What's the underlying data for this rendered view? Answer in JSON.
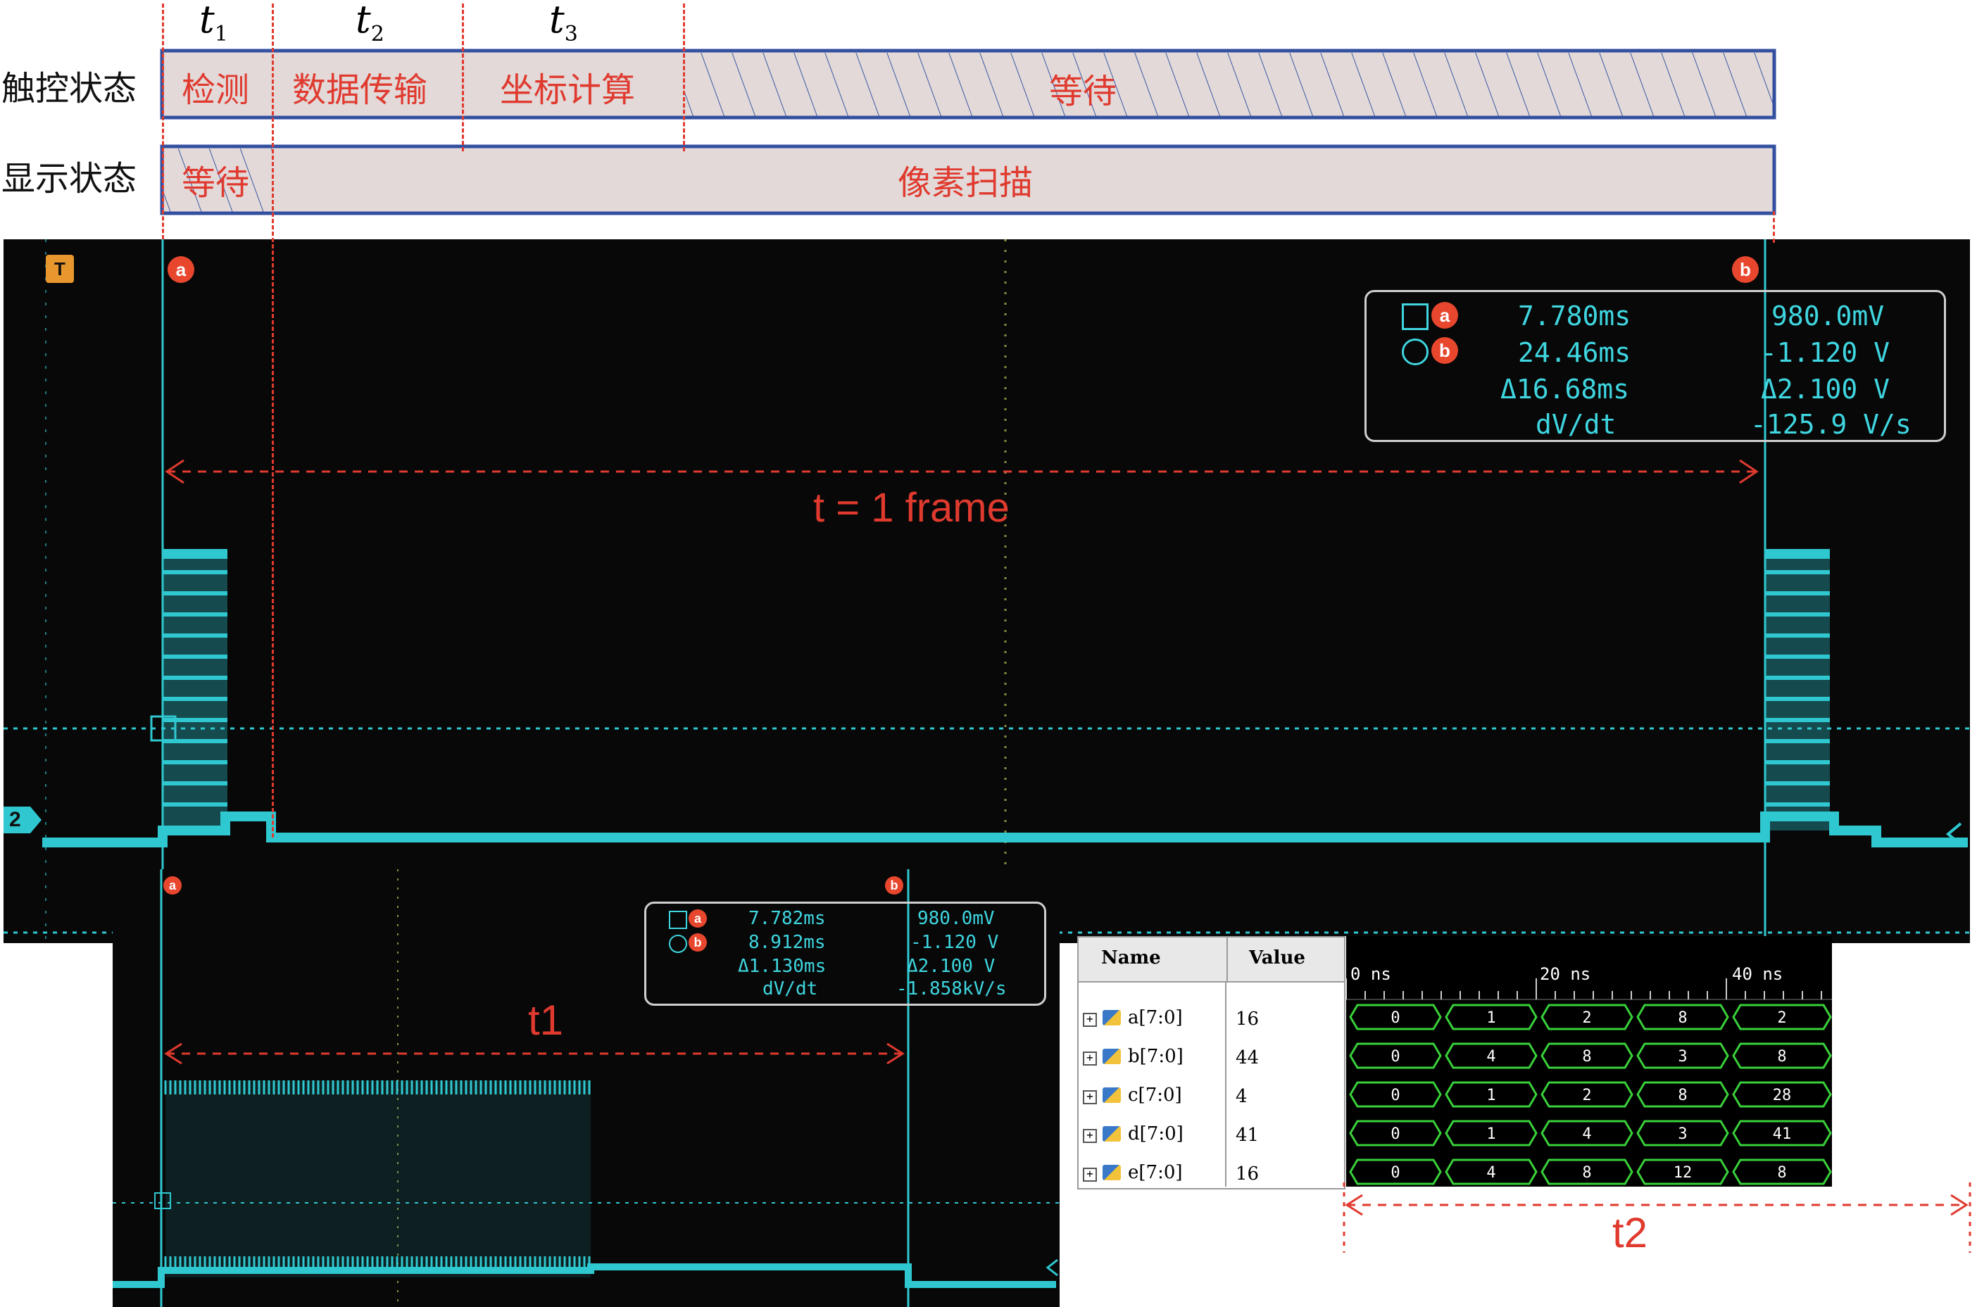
{
  "timeline": {
    "t_labels": [
      {
        "main": "t",
        "sub": "1"
      },
      {
        "main": "t",
        "sub": "2"
      },
      {
        "main": "t",
        "sub": "3"
      }
    ],
    "touch_row": {
      "label": "触控状态",
      "phases": [
        "检测",
        "数据传输",
        "坐标计算",
        "等待"
      ]
    },
    "display_row": {
      "label": "显示状态",
      "phases": [
        "等待",
        "像素扫描"
      ]
    },
    "colors": {
      "bar_fill": "#e2d9d8",
      "bar_border": "#3350a0",
      "phase_text": "#e03a2f",
      "dash": "#e03a2f"
    }
  },
  "main_scope": {
    "trigger_icon": "T",
    "channel": "2",
    "cursor_a": "a",
    "cursor_b": "b",
    "measurements": {
      "a_time": "7.780ms",
      "a_volt": "980.0mV",
      "b_time": "24.46ms",
      "b_volt": "-1.120 V",
      "delta_time": "Δ16.68ms",
      "delta_volt": "Δ2.100 V",
      "dvdt_label": "dV/dt",
      "dvdt_value": "-125.9 V/s"
    },
    "annotation": "t = 1 frame",
    "colors": {
      "trace": "#2fc8d0",
      "background": "#080808"
    }
  },
  "zoom_scope": {
    "cursor_a": "a",
    "cursor_b": "b",
    "measurements": {
      "a_time": "7.782ms",
      "a_volt": "980.0mV",
      "b_time": "8.912ms",
      "b_volt": "-1.120 V",
      "delta_time": "Δ1.130ms",
      "delta_volt": "Δ2.100 V",
      "dvdt_label": "dV/dt",
      "dvdt_value": "-1.858kV/s"
    },
    "annotation": "t1"
  },
  "logic_analyzer": {
    "col_name": "Name",
    "col_value": "Value",
    "ticks": [
      "0 ns",
      "20 ns",
      "40 ns"
    ],
    "signals": [
      {
        "name": "a[7:0]",
        "value": "16",
        "cells": [
          "0",
          "1",
          "2",
          "8",
          "2"
        ]
      },
      {
        "name": "b[7:0]",
        "value": "44",
        "cells": [
          "0",
          "4",
          "8",
          "3",
          "8"
        ]
      },
      {
        "name": "c[7:0]",
        "value": "4",
        "cells": [
          "0",
          "1",
          "2",
          "8",
          "28"
        ]
      },
      {
        "name": "d[7:0]",
        "value": "41",
        "cells": [
          "0",
          "1",
          "4",
          "3",
          "41"
        ]
      },
      {
        "name": "e[7:0]",
        "value": "16",
        "cells": [
          "0",
          "4",
          "8",
          "12",
          "8"
        ]
      }
    ],
    "annotation": "t2",
    "colors": {
      "bus": "#39d13a"
    }
  }
}
